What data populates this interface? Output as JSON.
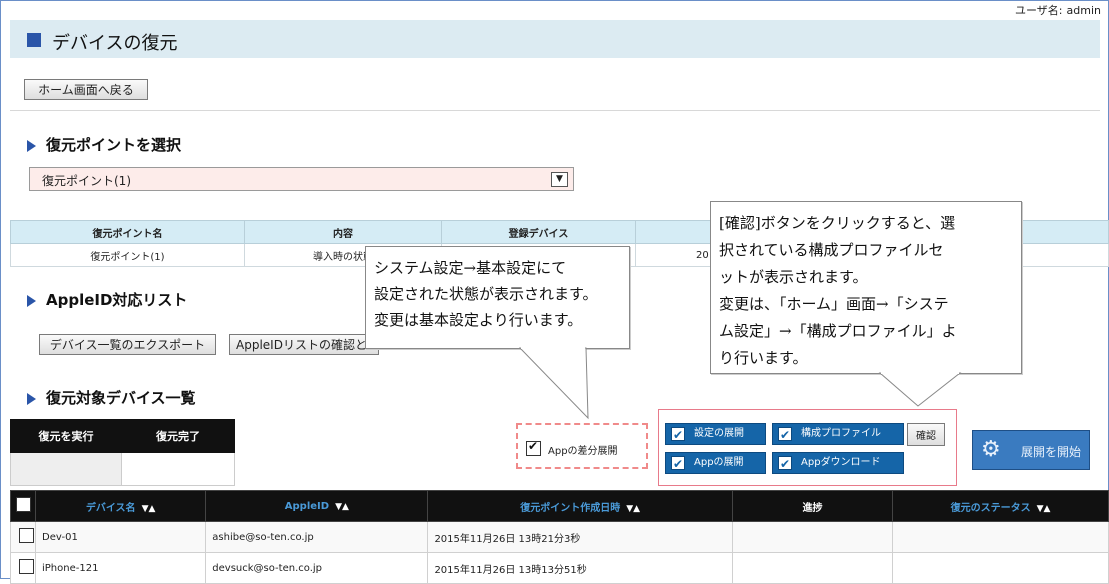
{
  "header": {
    "username_label": "ユーザ名:",
    "username": "admin",
    "page_title": "デバイスの復元"
  },
  "home_button": "ホーム画面へ戻る",
  "restore_point_section": {
    "title": "復元ポイントを選択",
    "selected": "復元ポイント(1)"
  },
  "restore_point_table": {
    "headers": [
      "復元ポイント名",
      "内容",
      "登録デバイス"
    ],
    "row": [
      "復元ポイント(1)",
      "導入時の状態",
      "20"
    ]
  },
  "appleid_section": {
    "title": "AppleID対応リスト",
    "export_button": "デバイス一覧のエクスポート",
    "check_button": "AppleIDリストの確認と"
  },
  "target_section": {
    "title": "復元対象デバイス一覧"
  },
  "status_table": {
    "headers": [
      "復元を実行",
      "復元完了"
    ]
  },
  "options": {
    "app_diff_deploy": "Appの差分展開",
    "settings_deploy": "設定の展開",
    "config_profile": "構成プロファイル",
    "app_deploy": "Appの展開",
    "app_download": "Appダウンロード",
    "confirm": "確認",
    "start_deploy": "展開を開始"
  },
  "devices_table": {
    "headers": [
      "デバイス名",
      "AppleID",
      "復元ポイント作成日時",
      "進捗",
      "復元のステータス"
    ],
    "rows": [
      {
        "name": "Dev-01",
        "appleid": "ashibe@so-ten.co.jp",
        "created": "2015年11月26日 13時21分3秒",
        "progress": "",
        "status": ""
      },
      {
        "name": "iPhone-121",
        "appleid": "devsuck@so-ten.co.jp",
        "created": "2015年11月26日 13時13分51秒",
        "progress": "",
        "status": ""
      }
    ]
  },
  "callouts": {
    "c1_lines": [
      "システム設定→基本設定にて",
      "設定された状態が表示されます。",
      "変更は基本設定より行います。"
    ],
    "c2_lines": [
      "[確認]ボタンをクリックすると、選",
      "択されている構成プロファイルセ",
      "ットが表示されます。",
      "変更は、「ホーム」画面→「システ",
      "ム設定」→「構成プロファイル」よ",
      "り行います。"
    ]
  }
}
